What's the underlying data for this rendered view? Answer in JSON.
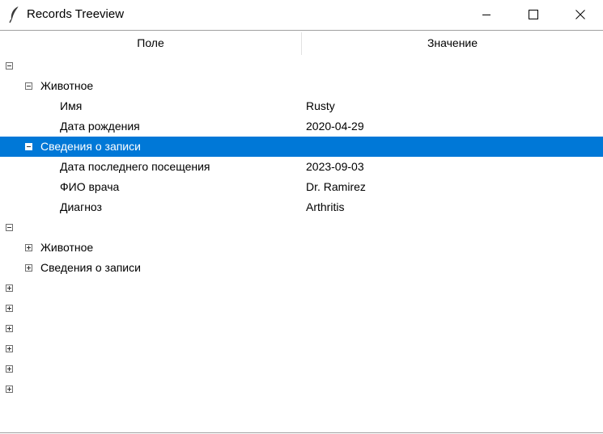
{
  "window": {
    "title": "Records Treeview",
    "icon": "feather-icon"
  },
  "tree": {
    "columns": [
      "Поле",
      "Значение"
    ],
    "rows": [
      {
        "level": 0,
        "state": "expanded",
        "label": "",
        "value": ""
      },
      {
        "level": 1,
        "state": "expanded",
        "label": "Животное",
        "value": ""
      },
      {
        "level": 2,
        "state": "leaf",
        "label": "Имя",
        "value": "Rusty"
      },
      {
        "level": 2,
        "state": "leaf",
        "label": "Дата рождения",
        "value": "2020-04-29"
      },
      {
        "level": 1,
        "state": "expanded",
        "label": "Сведения о записи",
        "value": "",
        "selected": true
      },
      {
        "level": 2,
        "state": "leaf",
        "label": "Дата последнего посещения",
        "value": "2023-09-03"
      },
      {
        "level": 2,
        "state": "leaf",
        "label": "ФИО врача",
        "value": "Dr. Ramirez"
      },
      {
        "level": 2,
        "state": "leaf",
        "label": "Диагноз",
        "value": "Arthritis"
      },
      {
        "level": 0,
        "state": "expanded",
        "label": "",
        "value": ""
      },
      {
        "level": 1,
        "state": "collapsed",
        "label": "Животное",
        "value": ""
      },
      {
        "level": 1,
        "state": "collapsed",
        "label": "Сведения о записи",
        "value": ""
      },
      {
        "level": 0,
        "state": "collapsed",
        "label": "",
        "value": ""
      },
      {
        "level": 0,
        "state": "collapsed",
        "label": "",
        "value": ""
      },
      {
        "level": 0,
        "state": "collapsed",
        "label": "",
        "value": ""
      },
      {
        "level": 0,
        "state": "collapsed",
        "label": "",
        "value": ""
      },
      {
        "level": 0,
        "state": "collapsed",
        "label": "",
        "value": ""
      },
      {
        "level": 0,
        "state": "collapsed",
        "label": "",
        "value": ""
      }
    ]
  },
  "colors": {
    "selection": "#0078d7",
    "selection_text": "#ffffff"
  }
}
